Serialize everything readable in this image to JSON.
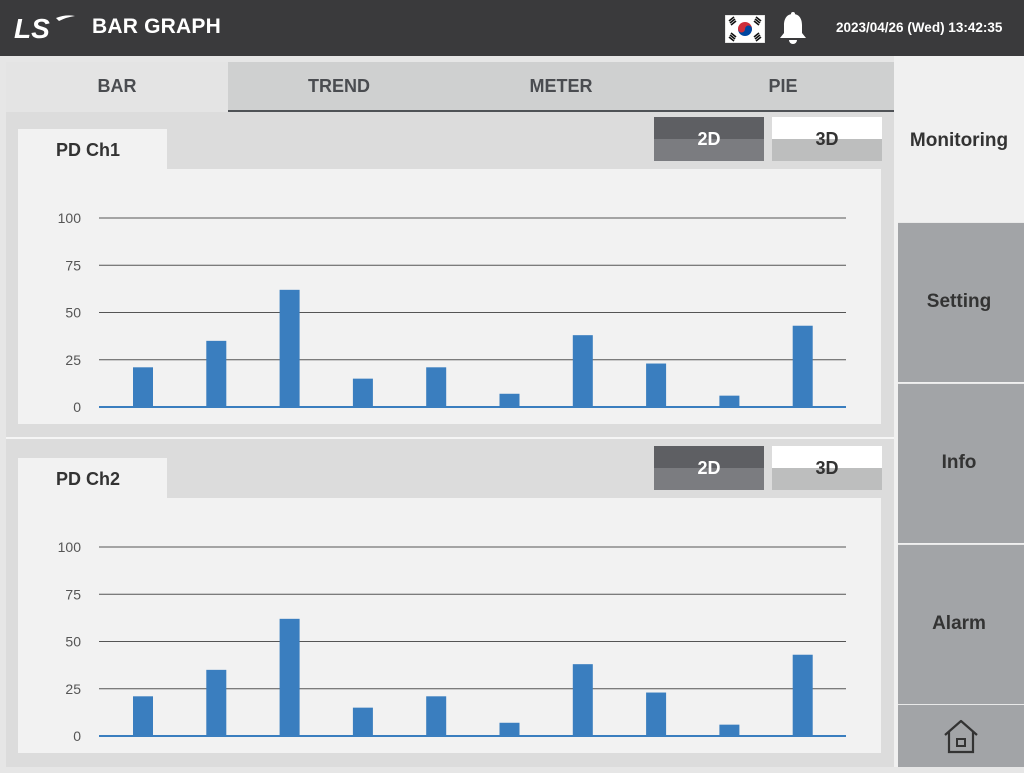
{
  "header": {
    "logo_text": "LS",
    "title": "BAR GRAPH",
    "datetime": "2023/04/26 (Wed) 13:42:35",
    "flag_icon": "korea-flag-icon",
    "bell_icon": "bell-icon"
  },
  "tabs": [
    {
      "label": "BAR",
      "active": true
    },
    {
      "label": "TREND",
      "active": false
    },
    {
      "label": "METER",
      "active": false
    },
    {
      "label": "PIE",
      "active": false
    }
  ],
  "toggles": {
    "label_2d": "2D",
    "label_3d": "3D"
  },
  "sidebar": {
    "header_label": "Monitoring",
    "buttons": [
      "Setting",
      "Info",
      "Alarm"
    ],
    "home_icon": "home-icon"
  },
  "colors": {
    "header_bg": "#3a3a3c",
    "bar": "#3a7ebf",
    "sidebar_button": "#a2a4a7",
    "toggle_active": "#5e5f63"
  },
  "chart_data": [
    {
      "type": "bar",
      "title": "PD Ch1",
      "yticks": [
        0,
        25,
        50,
        75,
        100
      ],
      "ylim": [
        0,
        100
      ],
      "grid": true,
      "values": [
        21,
        35,
        62,
        15,
        21,
        7,
        38,
        23,
        6,
        43
      ]
    },
    {
      "type": "bar",
      "title": "PD Ch2",
      "yticks": [
        0,
        25,
        50,
        75,
        100
      ],
      "ylim": [
        0,
        100
      ],
      "grid": true,
      "values": [
        21,
        35,
        62,
        15,
        21,
        7,
        38,
        23,
        6,
        43
      ]
    }
  ]
}
